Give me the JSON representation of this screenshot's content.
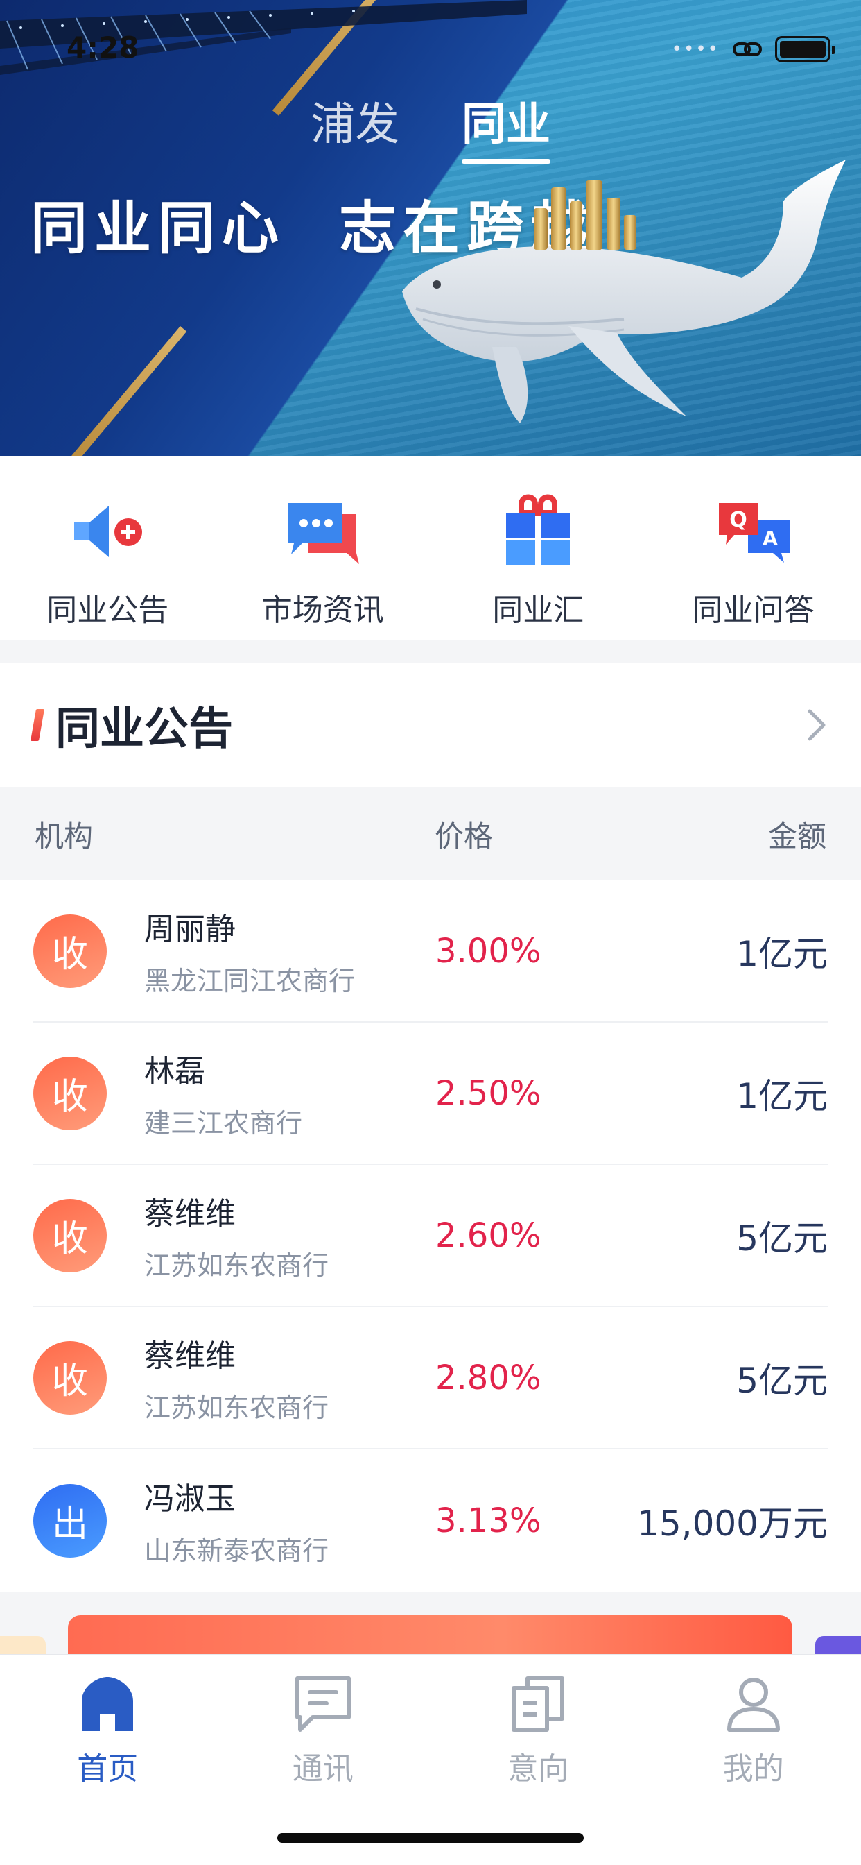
{
  "status_bar": {
    "time": "4:28",
    "signal": "••••"
  },
  "top_tabs": [
    {
      "label": "浦发",
      "active": false
    },
    {
      "label": "同业",
      "active": true
    }
  ],
  "banner": {
    "slogan": "同业同心  志在跨越"
  },
  "quick_menu": [
    {
      "label": "同业公告",
      "icon": "megaphone-icon"
    },
    {
      "label": "市场资讯",
      "icon": "chat-bubbles-icon"
    },
    {
      "label": "同业汇",
      "icon": "gift-box-icon"
    },
    {
      "label": "同业问答",
      "icon": "qa-bubbles-icon"
    }
  ],
  "announcements": {
    "title": "同业公告",
    "columns": {
      "org": "机构",
      "price": "价格",
      "amount": "金额"
    },
    "rows": [
      {
        "type": "收",
        "kind": "receive",
        "person": "周丽静",
        "institution": "黑龙江同江农商行",
        "price": "3.00%",
        "amount": "1亿元"
      },
      {
        "type": "收",
        "kind": "receive",
        "person": "林磊",
        "institution": "建三江农商行",
        "price": "2.50%",
        "amount": "1亿元"
      },
      {
        "type": "收",
        "kind": "receive",
        "person": "蔡维维",
        "institution": "江苏如东农商行",
        "price": "2.60%",
        "amount": "5亿元"
      },
      {
        "type": "收",
        "kind": "receive",
        "person": "蔡维维",
        "institution": "江苏如东农商行",
        "price": "2.80%",
        "amount": "5亿元"
      },
      {
        "type": "出",
        "kind": "out",
        "person": "冯淑玉",
        "institution": "山东新泰农商行",
        "price": "3.13%",
        "amount": "15,000万元"
      }
    ]
  },
  "tab_bar": [
    {
      "label": "首页",
      "icon": "home-icon",
      "active": true
    },
    {
      "label": "通讯",
      "icon": "message-icon",
      "active": false
    },
    {
      "label": "意向",
      "icon": "intent-icon",
      "active": false
    },
    {
      "label": "我的",
      "icon": "profile-icon",
      "active": false
    }
  ],
  "colors": {
    "accent": "#2a5cc4",
    "price_red": "#e2234b",
    "receive_badge": "#ff7a5a",
    "out_badge": "#3a7ef5"
  }
}
